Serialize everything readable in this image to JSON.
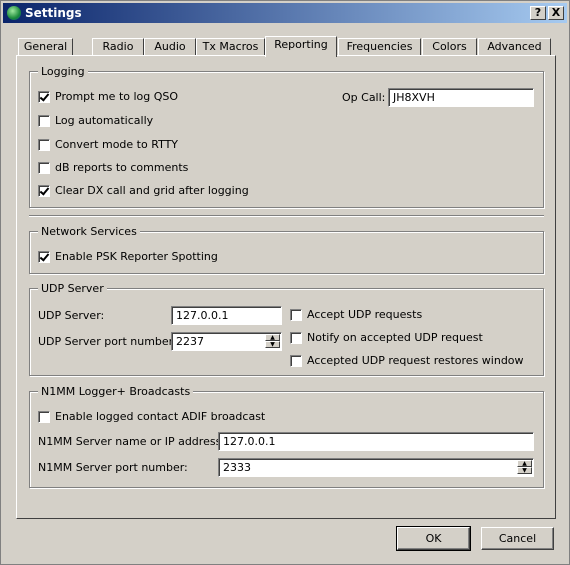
{
  "window": {
    "title": "Settings",
    "help_label": "?",
    "close_label": "X"
  },
  "tabs": [
    {
      "label": "General",
      "active": false
    },
    {
      "label": "Radio",
      "active": false
    },
    {
      "label": "Audio",
      "active": false
    },
    {
      "label": "Tx Macros",
      "active": false
    },
    {
      "label": "Reporting",
      "active": true
    },
    {
      "label": "Frequencies",
      "active": false
    },
    {
      "label": "Colors",
      "active": false
    },
    {
      "label": "Advanced",
      "active": false
    }
  ],
  "logging": {
    "title": "Logging",
    "prompt_log": {
      "label": "Prompt me to log QSO",
      "checked": true
    },
    "log_auto": {
      "label": "Log automatically",
      "checked": false
    },
    "convert_mode": {
      "label": "Convert mode to RTTY",
      "checked": false
    },
    "db_reports": {
      "label": "dB reports to comments",
      "checked": false
    },
    "clear_dx": {
      "label": "Clear DX call and grid after logging",
      "checked": true
    },
    "op_call_label": "Op Call:",
    "op_call_value": "JH8XVH"
  },
  "network": {
    "title": "Network Services",
    "psk_reporter": {
      "label": "Enable PSK Reporter Spotting",
      "checked": true
    }
  },
  "udp": {
    "title": "UDP Server",
    "server_label": "UDP Server:",
    "server_value": "127.0.0.1",
    "port_label": "UDP Server port number:",
    "port_value": "2237",
    "accept_requests": {
      "label": "Accept UDP requests",
      "checked": false
    },
    "notify_accepted": {
      "label": "Notify on accepted UDP request",
      "checked": false
    },
    "restores_window": {
      "label": "Accepted UDP request restores window",
      "checked": false
    }
  },
  "n1mm": {
    "title": "N1MM Logger+  Broadcasts",
    "enable_adif": {
      "label": "Enable logged contact ADIF broadcast",
      "checked": false
    },
    "server_label": "N1MM Server name or IP address:",
    "server_value": "127.0.0.1",
    "port_label": "N1MM Server port number:",
    "port_value": "2333"
  },
  "buttons": {
    "ok": "OK",
    "cancel": "Cancel"
  }
}
